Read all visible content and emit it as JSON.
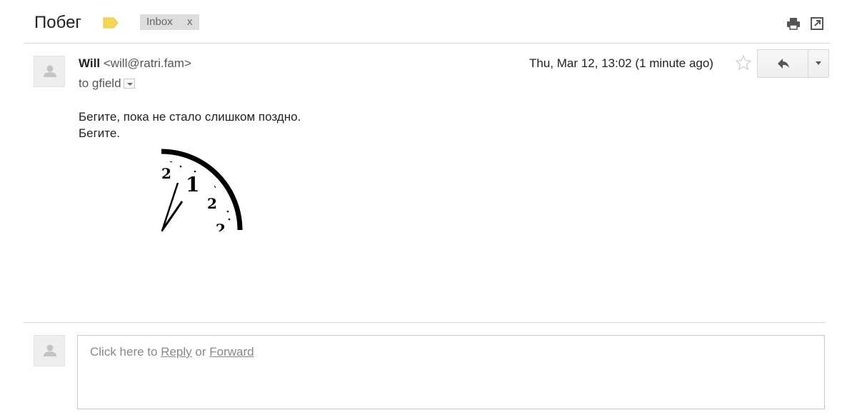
{
  "header": {
    "subject": "Побег",
    "label_color": "#f9d556",
    "inbox_label": "Inbox",
    "inbox_remove": "x",
    "print_icon": "print-icon",
    "new_window_icon": "new-window-icon"
  },
  "message": {
    "sender_name": "Will",
    "sender_email": "<will@ratri.fam>",
    "to_line": "to gfield",
    "datetime": "Thu, Mar 12, 13:02 (1 minute ago)",
    "body_lines": [
      "Бегите, пока не стало слишком поздно.",
      "Бегите."
    ],
    "clock_numerals": [
      "2",
      "1",
      "2",
      "2"
    ]
  },
  "reply": {
    "prefix": "Click here to ",
    "reply_link": "Reply",
    "middle": " or ",
    "forward_link": "Forward"
  }
}
